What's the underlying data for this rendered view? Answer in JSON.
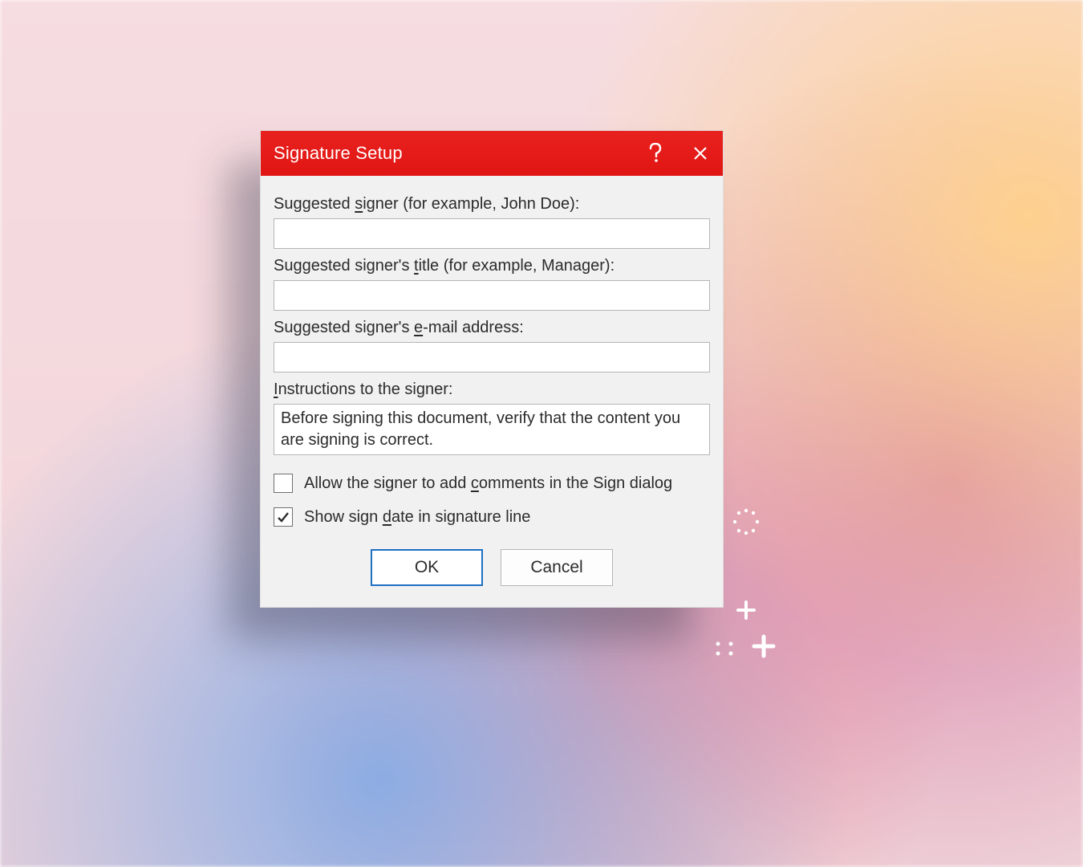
{
  "colors": {
    "titlebar": "#e11513",
    "primary_border": "#1f6fc3"
  },
  "dialog": {
    "title": "Signature Setup",
    "help_tooltip": "Help",
    "close_tooltip": "Close",
    "fields": {
      "signer": {
        "label_html": "Suggested <span class='u'>s</span>igner (for example, John Doe):",
        "value": ""
      },
      "title": {
        "label_html": "Suggested signer's <span class='u'>t</span>itle (for example, Manager):",
        "value": ""
      },
      "email": {
        "label_html": "Suggested signer's <span class='u'>e</span>-mail address:",
        "value": ""
      },
      "instructions": {
        "label_html": "<span class='u'>I</span>nstructions to the signer:",
        "value": "Before signing this document, verify that the content you are signing is correct."
      }
    },
    "checks": {
      "allow_comments": {
        "label_html": "Allow the signer to add <span class='u'>c</span>omments in the Sign dialog",
        "checked": false
      },
      "show_date": {
        "label_html": "Show sign <span class='u'>d</span>ate in signature line",
        "checked": true
      }
    },
    "buttons": {
      "ok": "OK",
      "cancel": "Cancel"
    }
  }
}
